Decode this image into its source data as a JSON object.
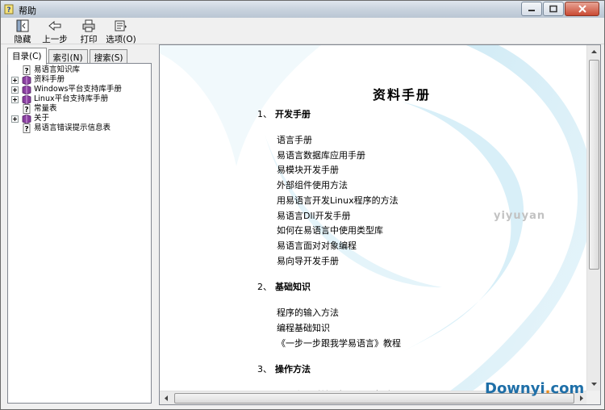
{
  "window": {
    "title": "帮助"
  },
  "toolbar": {
    "hide": "隐藏",
    "back": "上一步",
    "print": "打印",
    "options": "选项(O)"
  },
  "tabs": [
    "目录(C)",
    "索引(N)",
    "搜索(S)"
  ],
  "tree": [
    {
      "label": "易语言知识库",
      "icon": "help-page-icon",
      "expandable": false
    },
    {
      "label": "资料手册",
      "icon": "book-icon",
      "expandable": true
    },
    {
      "label": "Windows平台支持库手册",
      "icon": "book-icon",
      "expandable": true
    },
    {
      "label": "Linux平台支持库手册",
      "icon": "book-icon",
      "expandable": true
    },
    {
      "label": "常量表",
      "icon": "help-page-icon",
      "expandable": false
    },
    {
      "label": "关于",
      "icon": "book-icon",
      "expandable": true
    },
    {
      "label": "易语言错误提示信息表",
      "icon": "help-page-icon",
      "expandable": false
    }
  ],
  "doc": {
    "title": "资料手册",
    "sections": [
      {
        "num": "1、",
        "title": "开发手册",
        "items": [
          "语言手册",
          "易语言数据库应用手册",
          "易模块开发手册",
          "外部组件使用方法",
          "用易语言开发Linux程序的方法",
          "易语言Dll开发手册",
          "如何在易语言中使用类型库",
          "易语言面对对象编程",
          "易向导开发手册"
        ]
      },
      {
        "num": "2、",
        "title": "基础知识",
        "items": [
          "程序的输入方法",
          "编程基础知识",
          "《一步一步跟我学易语言》教程"
        ]
      },
      {
        "num": "3、",
        "title": "操作方法",
        "items": [
          "易语言即时输入提示使用帮助"
        ]
      }
    ],
    "watermark": "yiyuyan"
  },
  "brand": {
    "name": "Downyi",
    "dot": ".",
    "tld": "com"
  }
}
